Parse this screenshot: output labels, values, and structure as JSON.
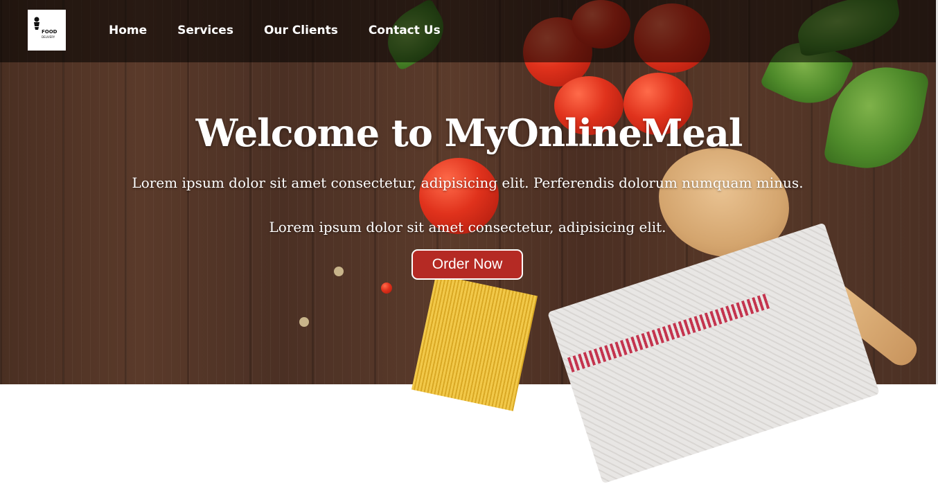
{
  "logo": {
    "line1": "FOOD",
    "line2": "DELIVERY",
    "icon": "chef-icon"
  },
  "nav": {
    "items": [
      {
        "label": "Home"
      },
      {
        "label": "Services"
      },
      {
        "label": "Our Clients"
      },
      {
        "label": "Contact Us"
      }
    ]
  },
  "hero": {
    "title": "Welcome to MyOnlineMeal",
    "paragraph1": "Lorem ipsum dolor sit amet consectetur, adipisicing elit. Perferendis dolorum numquam minus.",
    "paragraph2": "Lorem ipsum dolor sit amet consectetur, adipisicing elit.",
    "button_label": "Order Now"
  },
  "colors": {
    "navbar_bg": "#000000",
    "button_bg": "#b52a24",
    "text": "#ffffff"
  }
}
